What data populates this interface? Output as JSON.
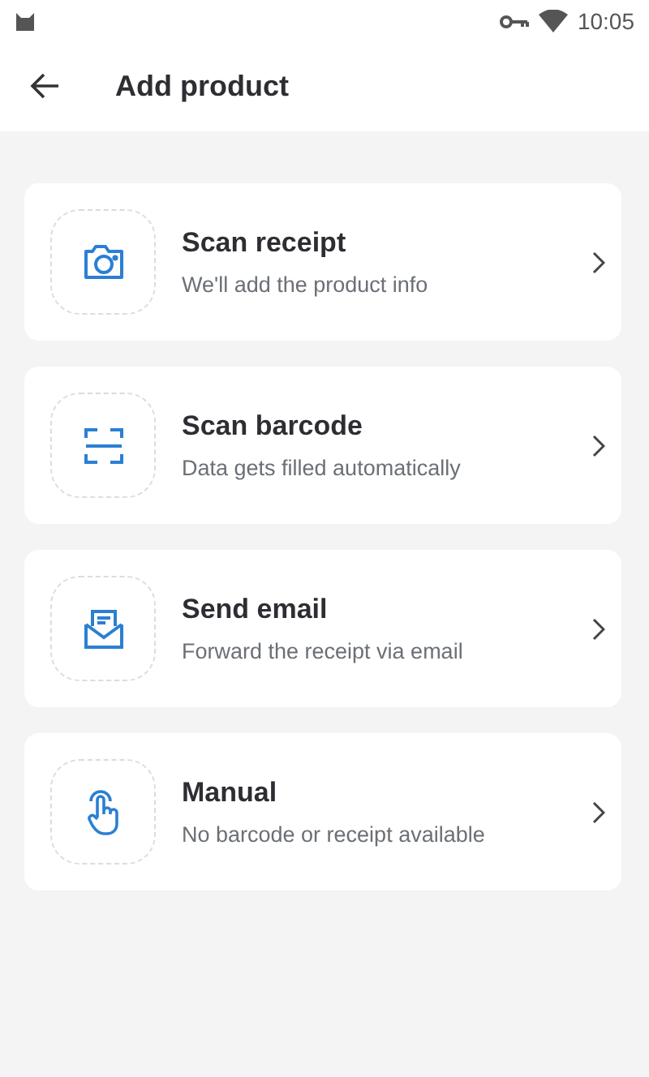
{
  "status_bar": {
    "time": "10:05"
  },
  "header": {
    "title": "Add product"
  },
  "options": [
    {
      "kind": "camera",
      "title": "Scan receipt",
      "subtitle": "We'll add the product info"
    },
    {
      "kind": "barcode",
      "title": "Scan barcode",
      "subtitle": "Data gets filled automatically"
    },
    {
      "kind": "email",
      "title": "Send email",
      "subtitle": "Forward the receipt via email"
    },
    {
      "kind": "manual",
      "title": "Manual",
      "subtitle": "No barcode or receipt available"
    }
  ]
}
